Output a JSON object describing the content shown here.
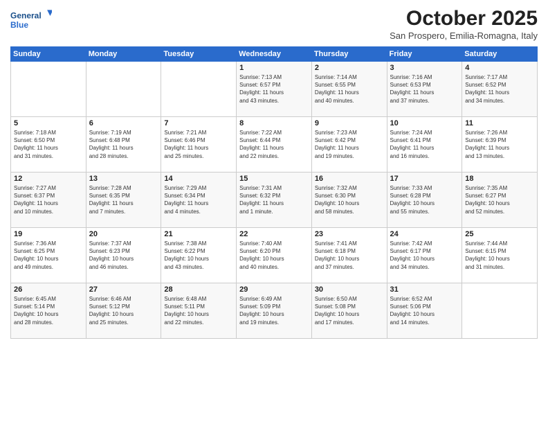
{
  "logo": {
    "line1": "General",
    "line2": "Blue"
  },
  "title": "October 2025",
  "subtitle": "San Prospero, Emilia-Romagna, Italy",
  "days_of_week": [
    "Sunday",
    "Monday",
    "Tuesday",
    "Wednesday",
    "Thursday",
    "Friday",
    "Saturday"
  ],
  "weeks": [
    [
      {
        "day": "",
        "content": ""
      },
      {
        "day": "",
        "content": ""
      },
      {
        "day": "",
        "content": ""
      },
      {
        "day": "1",
        "content": "Sunrise: 7:13 AM\nSunset: 6:57 PM\nDaylight: 11 hours\nand 43 minutes."
      },
      {
        "day": "2",
        "content": "Sunrise: 7:14 AM\nSunset: 6:55 PM\nDaylight: 11 hours\nand 40 minutes."
      },
      {
        "day": "3",
        "content": "Sunrise: 7:16 AM\nSunset: 6:53 PM\nDaylight: 11 hours\nand 37 minutes."
      },
      {
        "day": "4",
        "content": "Sunrise: 7:17 AM\nSunset: 6:52 PM\nDaylight: 11 hours\nand 34 minutes."
      }
    ],
    [
      {
        "day": "5",
        "content": "Sunrise: 7:18 AM\nSunset: 6:50 PM\nDaylight: 11 hours\nand 31 minutes."
      },
      {
        "day": "6",
        "content": "Sunrise: 7:19 AM\nSunset: 6:48 PM\nDaylight: 11 hours\nand 28 minutes."
      },
      {
        "day": "7",
        "content": "Sunrise: 7:21 AM\nSunset: 6:46 PM\nDaylight: 11 hours\nand 25 minutes."
      },
      {
        "day": "8",
        "content": "Sunrise: 7:22 AM\nSunset: 6:44 PM\nDaylight: 11 hours\nand 22 minutes."
      },
      {
        "day": "9",
        "content": "Sunrise: 7:23 AM\nSunset: 6:42 PM\nDaylight: 11 hours\nand 19 minutes."
      },
      {
        "day": "10",
        "content": "Sunrise: 7:24 AM\nSunset: 6:41 PM\nDaylight: 11 hours\nand 16 minutes."
      },
      {
        "day": "11",
        "content": "Sunrise: 7:26 AM\nSunset: 6:39 PM\nDaylight: 11 hours\nand 13 minutes."
      }
    ],
    [
      {
        "day": "12",
        "content": "Sunrise: 7:27 AM\nSunset: 6:37 PM\nDaylight: 11 hours\nand 10 minutes."
      },
      {
        "day": "13",
        "content": "Sunrise: 7:28 AM\nSunset: 6:35 PM\nDaylight: 11 hours\nand 7 minutes."
      },
      {
        "day": "14",
        "content": "Sunrise: 7:29 AM\nSunset: 6:34 PM\nDaylight: 11 hours\nand 4 minutes."
      },
      {
        "day": "15",
        "content": "Sunrise: 7:31 AM\nSunset: 6:32 PM\nDaylight: 11 hours\nand 1 minute."
      },
      {
        "day": "16",
        "content": "Sunrise: 7:32 AM\nSunset: 6:30 PM\nDaylight: 10 hours\nand 58 minutes."
      },
      {
        "day": "17",
        "content": "Sunrise: 7:33 AM\nSunset: 6:28 PM\nDaylight: 10 hours\nand 55 minutes."
      },
      {
        "day": "18",
        "content": "Sunrise: 7:35 AM\nSunset: 6:27 PM\nDaylight: 10 hours\nand 52 minutes."
      }
    ],
    [
      {
        "day": "19",
        "content": "Sunrise: 7:36 AM\nSunset: 6:25 PM\nDaylight: 10 hours\nand 49 minutes."
      },
      {
        "day": "20",
        "content": "Sunrise: 7:37 AM\nSunset: 6:23 PM\nDaylight: 10 hours\nand 46 minutes."
      },
      {
        "day": "21",
        "content": "Sunrise: 7:38 AM\nSunset: 6:22 PM\nDaylight: 10 hours\nand 43 minutes."
      },
      {
        "day": "22",
        "content": "Sunrise: 7:40 AM\nSunset: 6:20 PM\nDaylight: 10 hours\nand 40 minutes."
      },
      {
        "day": "23",
        "content": "Sunrise: 7:41 AM\nSunset: 6:18 PM\nDaylight: 10 hours\nand 37 minutes."
      },
      {
        "day": "24",
        "content": "Sunrise: 7:42 AM\nSunset: 6:17 PM\nDaylight: 10 hours\nand 34 minutes."
      },
      {
        "day": "25",
        "content": "Sunrise: 7:44 AM\nSunset: 6:15 PM\nDaylight: 10 hours\nand 31 minutes."
      }
    ],
    [
      {
        "day": "26",
        "content": "Sunrise: 6:45 AM\nSunset: 5:14 PM\nDaylight: 10 hours\nand 28 minutes."
      },
      {
        "day": "27",
        "content": "Sunrise: 6:46 AM\nSunset: 5:12 PM\nDaylight: 10 hours\nand 25 minutes."
      },
      {
        "day": "28",
        "content": "Sunrise: 6:48 AM\nSunset: 5:11 PM\nDaylight: 10 hours\nand 22 minutes."
      },
      {
        "day": "29",
        "content": "Sunrise: 6:49 AM\nSunset: 5:09 PM\nDaylight: 10 hours\nand 19 minutes."
      },
      {
        "day": "30",
        "content": "Sunrise: 6:50 AM\nSunset: 5:08 PM\nDaylight: 10 hours\nand 17 minutes."
      },
      {
        "day": "31",
        "content": "Sunrise: 6:52 AM\nSunset: 5:06 PM\nDaylight: 10 hours\nand 14 minutes."
      },
      {
        "day": "",
        "content": ""
      }
    ]
  ]
}
